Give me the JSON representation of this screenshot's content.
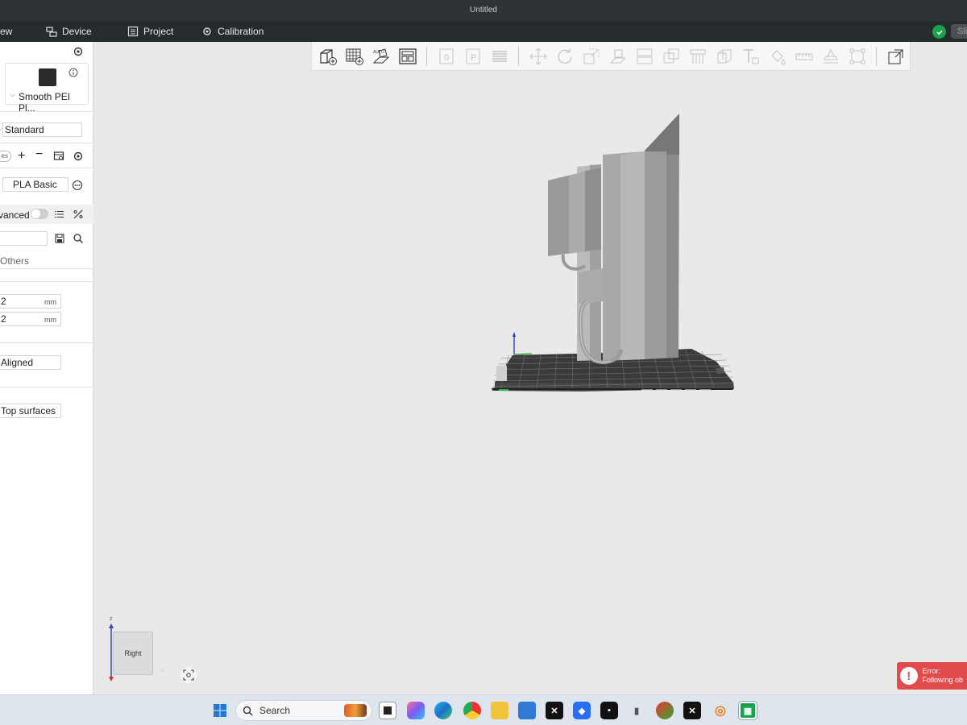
{
  "window": {
    "title": "Untitled"
  },
  "menubar": {
    "items": [
      {
        "label": "ew",
        "icon": ""
      },
      {
        "label": "Device",
        "icon": "device-icon"
      },
      {
        "label": "Project",
        "icon": "project-icon"
      },
      {
        "label": "Calibration",
        "icon": "calibration-icon"
      }
    ],
    "slice_label": "Slic"
  },
  "sidebar": {
    "plate_name": "Smooth PEI Pl...",
    "process_preset": "Standard",
    "filament_tab_label": "es",
    "filament_name": "PLA Basic",
    "advanced_label": "vanced",
    "advanced_on": false,
    "search_value": "",
    "others_tab": "Others",
    "field1_value": "2",
    "field1_unit": "mm",
    "field2_value": "2",
    "field2_unit": "mm",
    "seam_value": "Aligned",
    "ironing_value": "Top surfaces"
  },
  "viewport": {
    "view_cube_face": "Right",
    "axis_z_label": "z"
  },
  "toolbar": {
    "icons": [
      "add-object-icon",
      "arrange-grid-icon",
      "auto-orient-icon",
      "plate-layout-icon",
      "plate-0-icon",
      "plate-p-icon",
      "layers-icon",
      "move-icon",
      "rotate-icon",
      "scale-icon",
      "lay-on-face-icon",
      "cut-icon",
      "boolean-icon",
      "support-paint-icon",
      "seam-paint-icon",
      "text-icon",
      "color-paint-icon",
      "measure-icon",
      "assembly-icon",
      "fit-frame-icon",
      "split-view-icon"
    ]
  },
  "error": {
    "title": "Error:",
    "message": "Following ob"
  },
  "taskbar": {
    "search_placeholder": "Search"
  },
  "colors": {
    "titlebar": "#2d3336",
    "menubar": "#262b2e",
    "accent_green": "#1aa34a",
    "error_red": "#e14b4b"
  }
}
